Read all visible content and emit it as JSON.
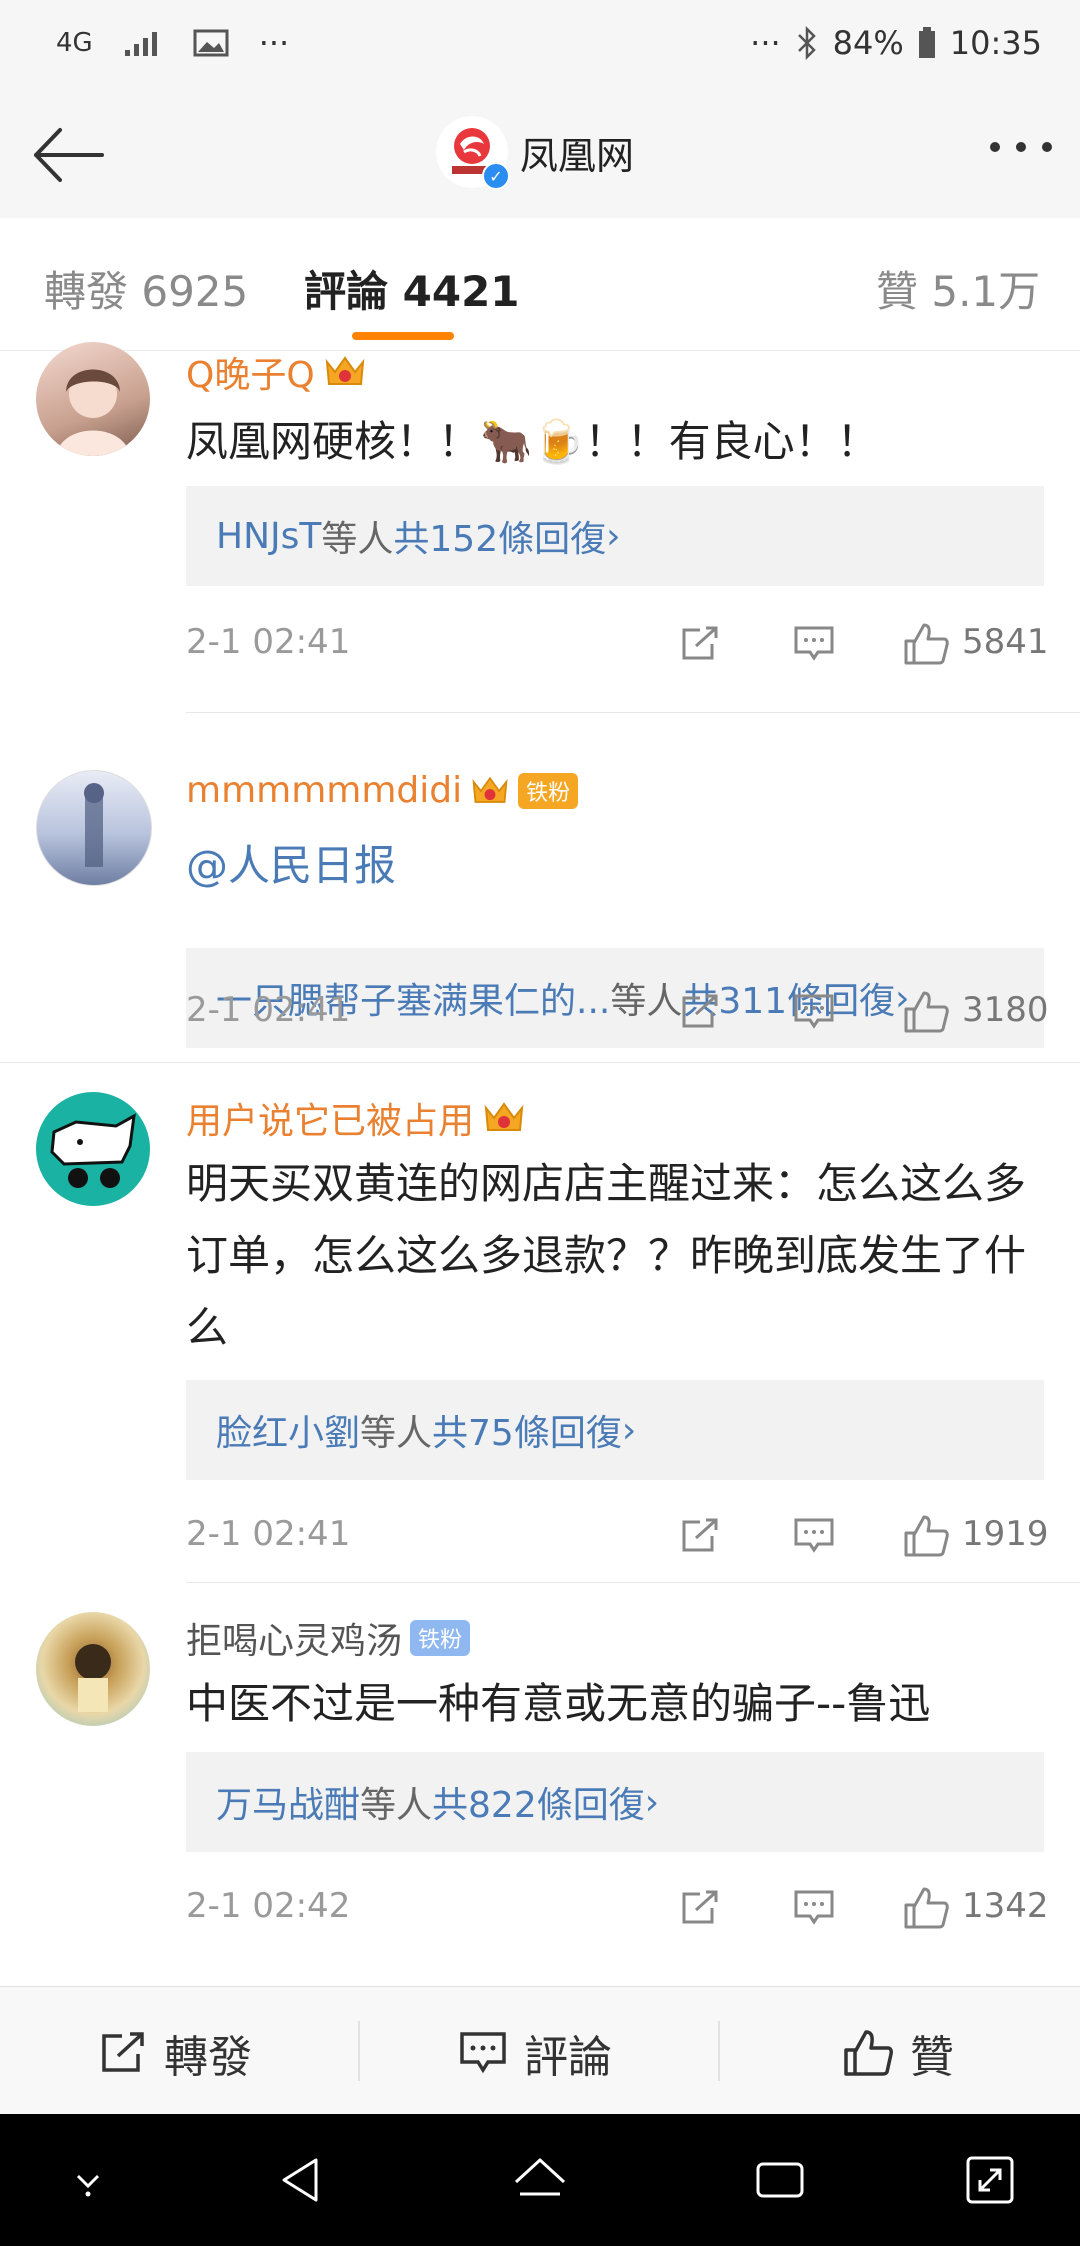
{
  "status": {
    "network": "4G",
    "battery": "84%",
    "time": "10:35",
    "left_icons": [
      "4g-icon",
      "signal-icon",
      "gallery-icon",
      "more-dots-icon"
    ],
    "right_icons": [
      "more-dots-icon",
      "bluetooth-icon",
      "battery-icon"
    ]
  },
  "header": {
    "title": "凤凰网",
    "verified": "✓"
  },
  "tabs": [
    {
      "label": "轉發 6925"
    },
    {
      "label": "評論 4421"
    },
    {
      "label": "贊 5.1万"
    }
  ],
  "comments": [
    {
      "username": "Q晚子Q",
      "username_color": "#e98131",
      "text": "凤凰网硬核！！🐂🍺！！有良心！！",
      "replies_prefix": "HNJsT",
      "replies_mid": "等人 ",
      "replies_count": "共152條回復 ",
      "replies_arrow": "›",
      "time": "2-1 02:41",
      "likes": "5841"
    },
    {
      "username": "mmmmmmdidi",
      "username_color": "#e98131",
      "badge": "铁粉",
      "text": "@人民日报",
      "text_color": "#4a7bb7",
      "replies_prefix": "一只腮帮子塞满果仁的...",
      "replies_mid": "等人 ",
      "replies_count": "共311條回復 ",
      "replies_arrow": "›",
      "time": "2-1 02:41",
      "likes": "3180"
    },
    {
      "username": "用户说它已被占用",
      "username_color": "#e98131",
      "text": "明天买双黄连的网店店主醒过来：怎么这么多订单，怎么这么多退款？？昨晚到底发生了什么",
      "replies_prefix": "脸红小劉",
      "replies_mid": "等人 ",
      "replies_count": "共75條回復 ",
      "replies_arrow": "›",
      "time": "2-1 02:41",
      "likes": "1919"
    },
    {
      "username": "拒喝心灵鸡汤",
      "username_color": "#555555",
      "badge": "铁粉",
      "text": "中医不过是一种有意或无意的骗子--鲁迅",
      "replies_prefix": "万马战酣",
      "replies_mid": "等人 ",
      "replies_count": "共822條回復 ",
      "replies_arrow": "›",
      "time": "2-1 02:42",
      "likes": "1342"
    }
  ],
  "bottom_bar": {
    "repost": "轉發",
    "comment": "評論",
    "like": "贊"
  },
  "colors": {
    "accent": "#ff8200",
    "link": "#4a7bb7"
  }
}
